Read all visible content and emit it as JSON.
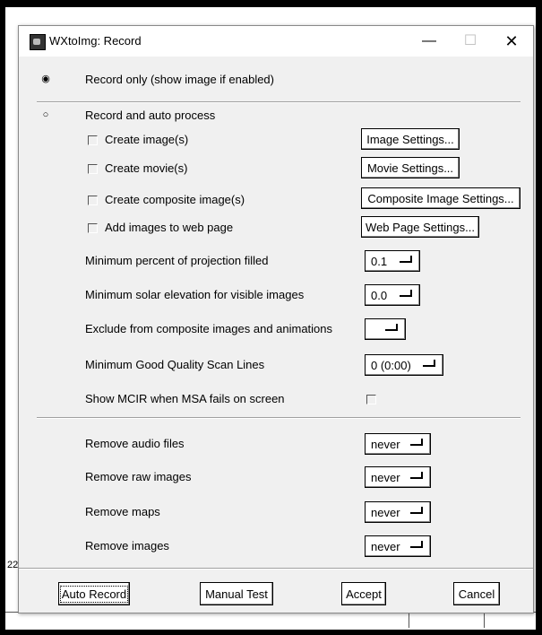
{
  "window": {
    "title": "WXtoImg: Record",
    "minimize_glyph": "—",
    "maximize_glyph": "☐",
    "close_glyph": "✕"
  },
  "mode": {
    "record_only_label": "Record only (show image if enabled)",
    "record_only_selected": true,
    "auto_process_label": "Record and auto process",
    "auto_process_selected": false
  },
  "options": [
    {
      "label": "Create image(s)",
      "checked": false,
      "button": "Image Settings..."
    },
    {
      "label": "Create movie(s)",
      "checked": false,
      "button": "Movie Settings..."
    },
    {
      "label": "Create composite image(s)",
      "checked": false,
      "button": "Composite Image Settings..."
    },
    {
      "label": "Add images to web page",
      "checked": false,
      "button": "Web Page Settings..."
    }
  ],
  "settings": [
    {
      "label": "Minimum percent of projection filled",
      "value": "0.1"
    },
    {
      "label": "Minimum solar elevation for visible images",
      "value": "0.0"
    },
    {
      "label": "Exclude from composite images and animations",
      "value": ""
    },
    {
      "label": "Minimum Good Quality Scan Lines",
      "value": "0 (0:00)"
    },
    {
      "label": "Show MCIR when MSA fails on screen",
      "checked": false
    }
  ],
  "removals": [
    {
      "label": "Remove audio files",
      "value": "never"
    },
    {
      "label": "Remove raw images",
      "value": "never"
    },
    {
      "label": "Remove maps",
      "value": "never"
    },
    {
      "label": "Remove images",
      "value": "never"
    }
  ],
  "buttons": {
    "auto_record": "Auto Record",
    "manual_test": "Manual Test",
    "accept": "Accept",
    "cancel": "Cancel"
  },
  "background": {
    "partial_number": "22"
  },
  "colors": {
    "dialog_bg": "#f0f0f0",
    "titlebar_bg": "#ffffff"
  }
}
